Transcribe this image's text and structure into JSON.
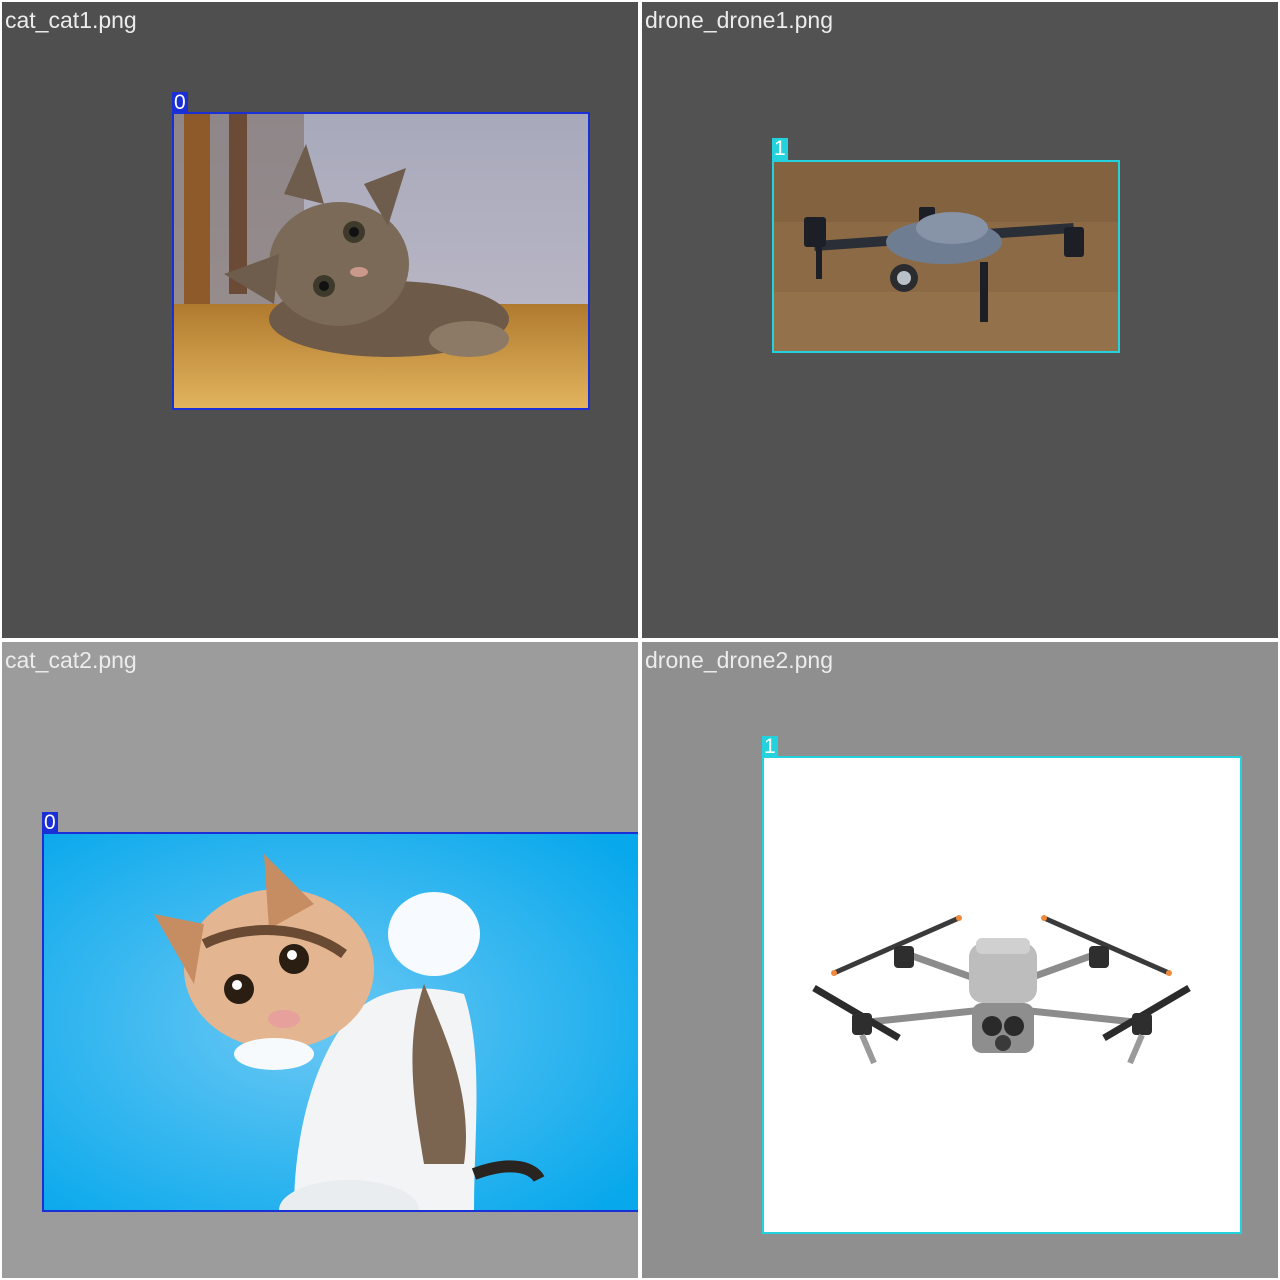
{
  "colors": {
    "class_0": "#1a2fd6",
    "class_1": "#23d2dc",
    "title_text": "#ececec"
  },
  "tiles": [
    {
      "filename": "cat_cat1.png",
      "boxes": [
        {
          "class_label": "0"
        }
      ]
    },
    {
      "filename": "drone_drone1.png",
      "boxes": [
        {
          "class_label": "1"
        }
      ]
    },
    {
      "filename": "cat_cat2.png",
      "boxes": [
        {
          "class_label": "0"
        }
      ]
    },
    {
      "filename": "drone_drone2.png",
      "boxes": [
        {
          "class_label": "1"
        }
      ]
    }
  ]
}
